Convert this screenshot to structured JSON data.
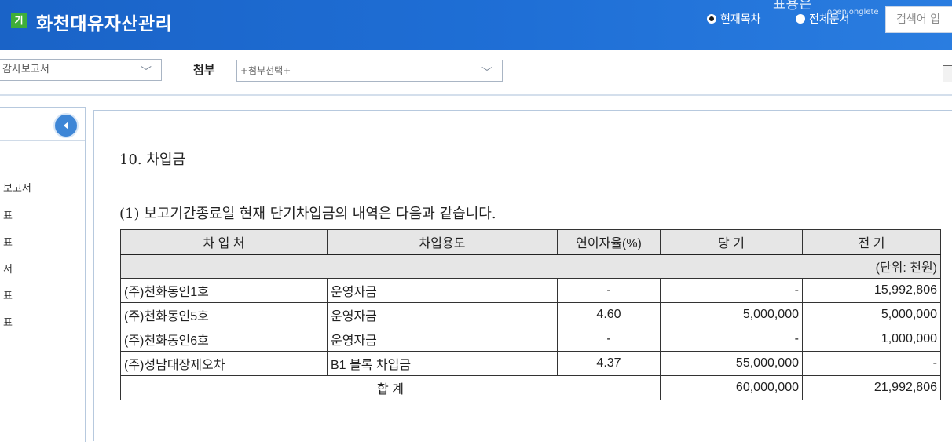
{
  "header": {
    "badge": "기",
    "title": "화천대유자산관리",
    "logo_text": "표용은 ",
    "logo_sub": "openjonglete",
    "scope_current": "현재목차",
    "scope_all": "전체문서",
    "search_placeholder": "검색어 입"
  },
  "toolbar": {
    "report_select_value": "감사보고서",
    "attach_label": "첨부",
    "attach_select_value": "+첨부선택+"
  },
  "sidebar": {
    "items": [
      "보고서",
      "표",
      "표",
      "서",
      "표",
      "표"
    ]
  },
  "document": {
    "heading": "10. 차입금",
    "intro": "(1) 보고기간종료일 현재 단기차입금의 내역은 다음과 같습니다.",
    "unit": "(단위: 천원)",
    "columns": [
      "차 입 처",
      "차입용도",
      "연이자율(%)",
      "당 기",
      "전 기"
    ],
    "rows": [
      {
        "lender": "(주)천화동인1호",
        "purpose": "운영자금",
        "rate": "-",
        "current": "-",
        "prior": "15,992,806"
      },
      {
        "lender": "(주)천화동인5호",
        "purpose": "운영자금",
        "rate": "4.60",
        "current": "5,000,000",
        "prior": "5,000,000"
      },
      {
        "lender": "(주)천화동인6호",
        "purpose": "운영자금",
        "rate": "-",
        "current": "-",
        "prior": "1,000,000"
      },
      {
        "lender": "(주)성남대장제오차",
        "purpose": "B1 블록 차입금",
        "rate": "4.37",
        "current": "55,000,000",
        "prior": "-"
      }
    ],
    "total": {
      "label": "합 계",
      "current": "60,000,000",
      "prior": "21,992,806"
    }
  },
  "colors": {
    "header_bg": "#1f6fd6",
    "badge_bg": "#3fae3a",
    "table_header_bg": "#e6e6e6",
    "sidebar_button": "#3e86d6"
  }
}
